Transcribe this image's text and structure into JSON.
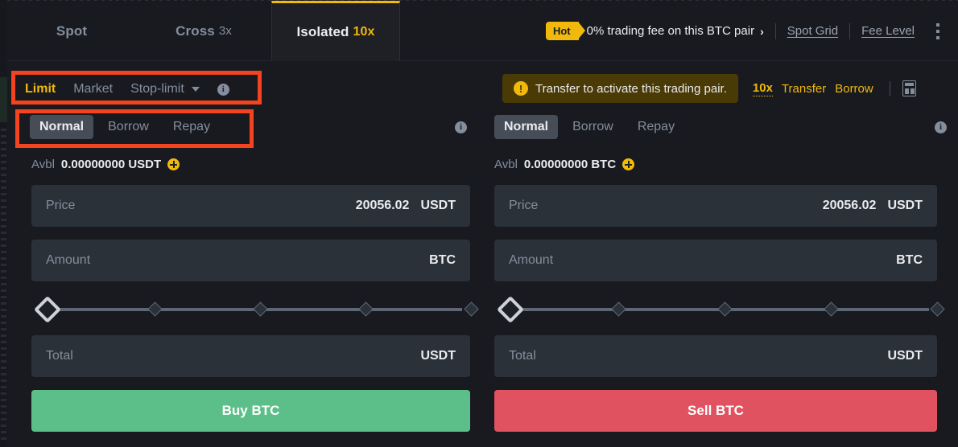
{
  "header": {
    "tabs": [
      {
        "label": "Spot",
        "leverage": "",
        "active": false
      },
      {
        "label": "Cross",
        "leverage": "3x",
        "active": false
      },
      {
        "label": "Isolated",
        "leverage": "10x",
        "active": true
      }
    ],
    "promo": {
      "badge": "Hot",
      "text": "0% trading fee on this BTC pair",
      "chevron": "›",
      "links": [
        "Spot Grid",
        "Fee Level"
      ],
      "kebab_icon": "more-vertical-icon"
    }
  },
  "order_types": {
    "items": [
      {
        "label": "Limit",
        "active": true
      },
      {
        "label": "Market",
        "active": false
      },
      {
        "label": "Stop-limit",
        "active": false
      }
    ],
    "caret_icon": "chevron-down-icon",
    "info_icon": "info-icon"
  },
  "warning": {
    "icon": "alert-icon",
    "text": "Transfer to activate this trading pair.",
    "leverage": "10x",
    "transfer_label": "Transfer",
    "borrow_label": "Borrow",
    "calculator_icon": "calculator-icon"
  },
  "modes": {
    "items": [
      {
        "label": "Normal",
        "active": true
      },
      {
        "label": "Borrow",
        "active": false
      },
      {
        "label": "Repay",
        "active": false
      }
    ],
    "info_icon": "info-icon"
  },
  "buy": {
    "avbl_label": "Avbl",
    "avbl_value": "0.00000000 USDT",
    "add_funds_icon": "plus-circle-icon",
    "price": {
      "placeholder": "Price",
      "value": "20056.02",
      "unit": "USDT"
    },
    "amount": {
      "placeholder": "Amount",
      "value": "",
      "unit": "BTC"
    },
    "total": {
      "placeholder": "Total",
      "value": "",
      "unit": "USDT"
    },
    "slider": {
      "value": 0,
      "ticks": [
        0,
        25,
        50,
        75,
        100
      ]
    },
    "action_label": "Buy BTC",
    "action_color": "#5cbf8a"
  },
  "sell": {
    "avbl_label": "Avbl",
    "avbl_value": "0.00000000 BTC",
    "add_funds_icon": "plus-circle-icon",
    "price": {
      "placeholder": "Price",
      "value": "20056.02",
      "unit": "USDT"
    },
    "amount": {
      "placeholder": "Amount",
      "value": "",
      "unit": "BTC"
    },
    "total": {
      "placeholder": "Total",
      "value": "",
      "unit": "USDT"
    },
    "slider": {
      "value": 0,
      "ticks": [
        0,
        25,
        50,
        75,
        100
      ]
    },
    "action_label": "Sell BTC",
    "action_color": "#e05260"
  },
  "theme": {
    "background": "#181a20",
    "panel": "#1e2026",
    "field": "#2b3139",
    "accent": "#f0b90b",
    "muted": "#848e9c",
    "text": "#eaecef",
    "annotation": "#f4431f"
  }
}
